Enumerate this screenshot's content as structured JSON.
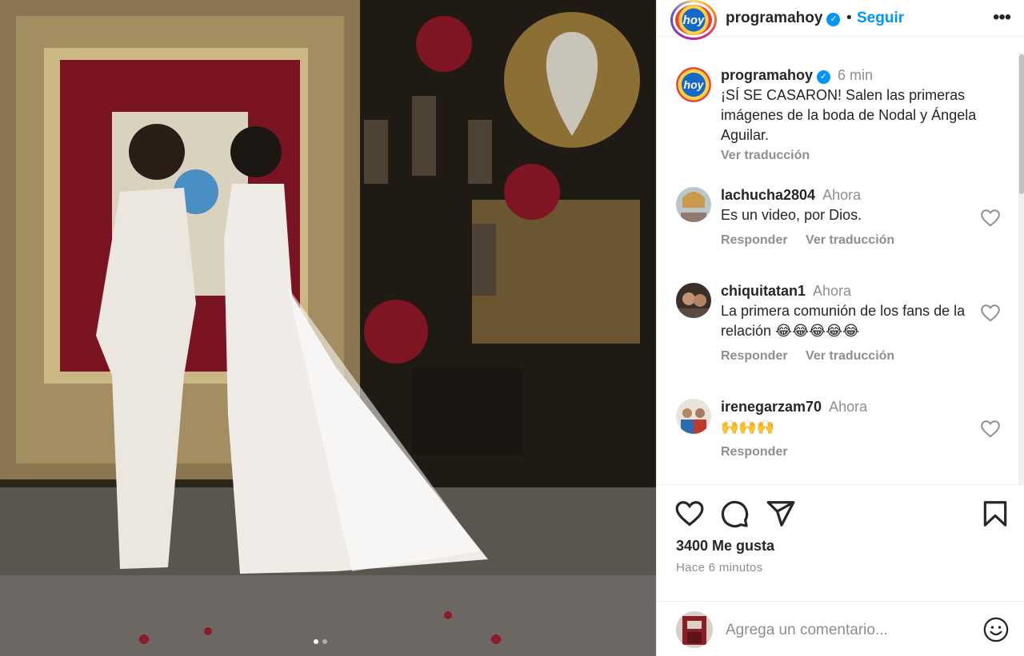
{
  "post": {
    "username": "programahoy",
    "avatar_text": "hoy",
    "follow_label": "Seguir",
    "more_icon": "more-horizontal-icon",
    "photo_alt": "Wedding photo",
    "carousel": {
      "count": 2,
      "active": 1
    }
  },
  "caption": {
    "username": "programahoy",
    "time": "6 min",
    "text": "¡SÍ SE CASARON! Salen las primeras imágenes de la boda de Nodal y Ángela Aguilar.",
    "translate_label": "Ver traducción"
  },
  "comments": [
    {
      "username": "lachucha2804",
      "time": "Ahora",
      "text": "Es un video, por Dios.",
      "reply_label": "Responder",
      "translate_label": "Ver traducción"
    },
    {
      "username": "chiquitatan1",
      "time": "Ahora",
      "text": "La primera comunión de los fans de la relación 😂😂😂😂😂",
      "reply_label": "Responder",
      "translate_label": "Ver traducción"
    },
    {
      "username": "irenegarzam70",
      "time": "Ahora",
      "text": "🙌🙌🙌",
      "reply_label": "Responder"
    }
  ],
  "footer": {
    "likes": "3400 Me gusta",
    "ago": "Hace 6 minutos",
    "comment_placeholder": "Agrega un comentario..."
  },
  "colors": {
    "accent": "#0095f6",
    "muted": "#8e8e8e",
    "text": "#262626"
  }
}
